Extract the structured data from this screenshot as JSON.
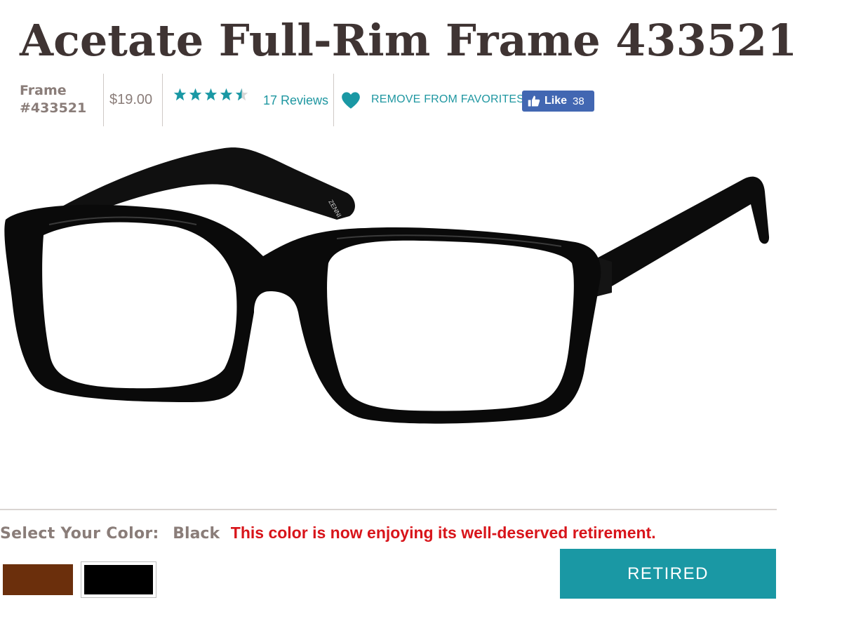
{
  "product": {
    "title": "Acetate Full-Rim Frame 433521",
    "frame_label": "Frame",
    "frame_number": "#433521",
    "price": "$19.00",
    "rating": 4.5,
    "reviews_text": "17 Reviews",
    "brand_mark": "ZENNI"
  },
  "actions": {
    "favorites_label": "REMOVE FROM FAVORITES",
    "fb_like_label": "Like",
    "fb_like_count": "38",
    "retired_button_label": "RETIRED"
  },
  "color_select": {
    "label": "Select Your Color:",
    "selected": "Black",
    "status_message": "This color is now enjoying its well-deserved retirement.",
    "swatches": [
      {
        "name": "Brown",
        "color": "#6b2f0c"
      },
      {
        "name": "Black",
        "color": "#000000"
      }
    ]
  },
  "colors": {
    "accent": "#1a98a4",
    "link": "#1f97a1",
    "title": "#3f3433",
    "muted": "#8a7d79",
    "alert": "#d8141a",
    "facebook": "#4267b2"
  }
}
